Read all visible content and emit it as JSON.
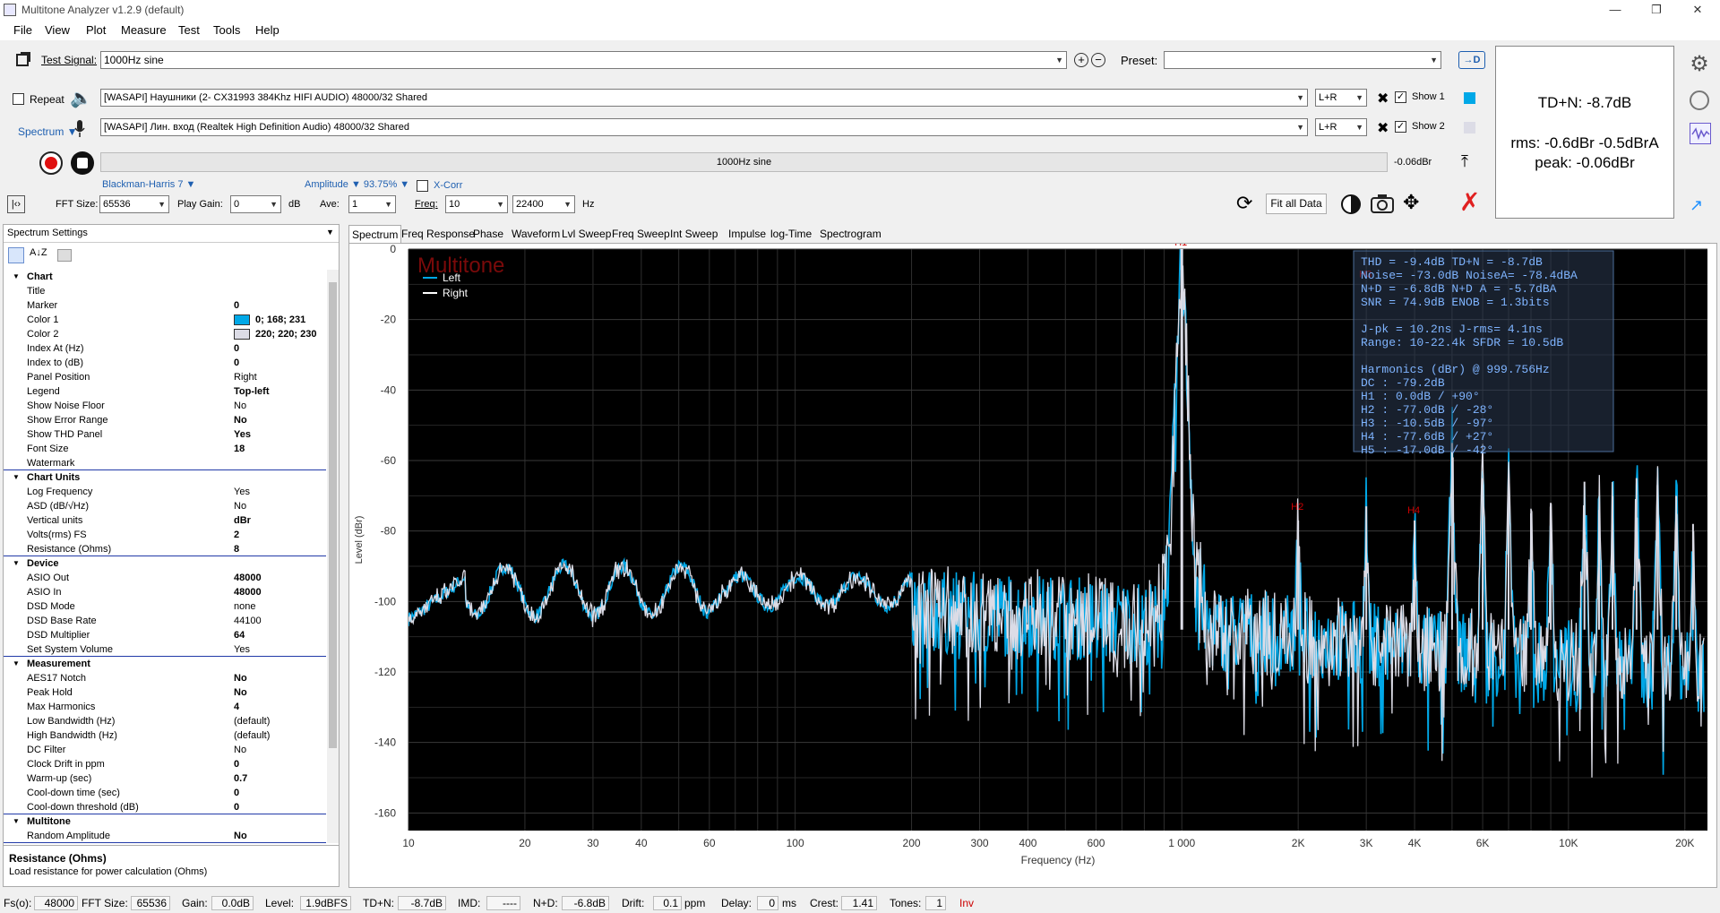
{
  "app": {
    "title": "Multitone Analyzer v1.2.9 (default)"
  },
  "menu": [
    "File",
    "View",
    "Plot",
    "Measure",
    "Test",
    "Tools",
    "Help"
  ],
  "toolbar": {
    "test_signal_label": "Test Signal:",
    "test_signal_value": "1000Hz sine",
    "preset_label": "Preset:",
    "preset_value": "",
    "repeat_label": "Repeat",
    "spectrum_label": "Spectrum ▼",
    "output_device": "[WASAPI] Наушники (2- CX31993 384Khz HIFI AUDIO) 48000/32 Shared",
    "input_device": "[WASAPI] Лин. вход (Realtek High Definition Audio) 48000/32 Shared",
    "output_channel": "L+R",
    "input_channel": "L+R",
    "show1_label": "Show 1",
    "show2_label": "Show 2",
    "signal_bar_text": "1000Hz sine",
    "level_text": "-0.06dBr",
    "window_label": "Blackman-Harris 7 ▼",
    "amplitude_label": "Amplitude ▼ 93.75% ▼",
    "xcorr_label": "X-Corr",
    "fft_size_label": "FFT Size:",
    "fft_size_value": "65536",
    "play_gain_label": "Play Gain:",
    "play_gain_value": "0",
    "play_gain_unit": "dB",
    "ave_label": "Ave:",
    "ave_value": "1",
    "freq_label": "Freq:",
    "freq_from": "10",
    "freq_to": "22400",
    "freq_unit": "Hz",
    "fit_all_label": "Fit all Data"
  },
  "colors": {
    "left": "#00a8e7",
    "right": "#dcdcdc",
    "plot_bg": "#000000",
    "grid": "#2e2e2e",
    "accent": "#1e90ff",
    "harm": "#cc0000"
  },
  "infobox": {
    "tdn": "TD+N: -8.7dB",
    "rms": "rms: -0.6dBr  -0.5dBrA",
    "peak": "peak: -0.06dBr"
  },
  "settings": {
    "header": "Spectrum Settings",
    "groups": [
      {
        "name": "Chart",
        "rows": [
          [
            "Title",
            ""
          ],
          [
            "Marker",
            "0"
          ],
          [
            "Color 1",
            "0; 168; 231"
          ],
          [
            "Color 2",
            "220; 220; 230"
          ],
          [
            "Index At (Hz)",
            "0"
          ],
          [
            "Index to (dB)",
            "0"
          ],
          [
            "Panel Position",
            "Right"
          ],
          [
            "Legend",
            "Top-left"
          ],
          [
            "Show Noise Floor",
            "No"
          ],
          [
            "Show Error Range",
            "No"
          ],
          [
            "Show THD Panel",
            "Yes"
          ],
          [
            "Font Size",
            "18"
          ],
          [
            "Watermark",
            ""
          ]
        ]
      },
      {
        "name": "Chart Units",
        "rows": [
          [
            "Log Frequency",
            "Yes"
          ],
          [
            "ASD (dB/√Hz)",
            "No"
          ],
          [
            "Vertical units",
            "dBr"
          ],
          [
            "Volts(rms) FS",
            "2"
          ],
          [
            "Resistance (Ohms)",
            "8"
          ]
        ]
      },
      {
        "name": "Device",
        "rows": [
          [
            "ASIO Out",
            "48000"
          ],
          [
            "ASIO In",
            "48000"
          ],
          [
            "DSD Mode",
            "none"
          ],
          [
            "DSD Base Rate",
            "44100"
          ],
          [
            "DSD Multiplier",
            "64"
          ],
          [
            "Set System Volume",
            "Yes"
          ]
        ]
      },
      {
        "name": "Measurement",
        "rows": [
          [
            "AES17 Notch",
            "No"
          ],
          [
            "Peak Hold",
            "No"
          ],
          [
            "Max Harmonics",
            "4"
          ],
          [
            "Low Bandwidth (Hz)",
            "(default)"
          ],
          [
            "High Bandwidth (Hz)",
            "(default)"
          ],
          [
            "DC Filter",
            "No"
          ],
          [
            "Clock Drift in ppm",
            "0"
          ],
          [
            "Warm-up (sec)",
            "0.7"
          ],
          [
            "Cool-down time (sec)",
            "0"
          ],
          [
            "Cool-down threshold (dB)",
            "0"
          ]
        ]
      },
      {
        "name": "Multitone",
        "rows": [
          [
            "Random Amplitude",
            "No"
          ]
        ]
      }
    ],
    "desc_title": "Resistance (Ohms)",
    "desc_text": "Load resistance for power calculation (Ohms)"
  },
  "tabs": [
    "Spectrum",
    "Freq Response",
    "Phase",
    "Waveform",
    "Lvl Sweep",
    "Freq Sweep",
    "Int Sweep",
    "Impulse",
    "log-Time",
    "Spectrogram"
  ],
  "chart_data": {
    "type": "line",
    "watermark": "Multitone",
    "xlabel": "Frequency (Hz)",
    "ylabel": "Level (dBr)",
    "xscale": "log",
    "xlim": [
      10,
      22400
    ],
    "ylim": [
      -165,
      0
    ],
    "grid": true,
    "legend": "top-left",
    "xticks": [
      "10",
      "20",
      "30",
      "40",
      "60",
      "100",
      "200",
      "300",
      "400",
      "600",
      "1 000",
      "2K",
      "3K",
      "4K",
      "6K",
      "10K",
      "20K"
    ],
    "yticks": [
      "0",
      "-20",
      "-40",
      "-60",
      "-80",
      "-100",
      "-120",
      "-140",
      "-160"
    ],
    "series": [
      {
        "name": "Left",
        "color": "#00a8e7"
      },
      {
        "name": "Right",
        "color": "#ffffff"
      }
    ],
    "fundamental_hz": 1000,
    "harmonic_peaks": [
      {
        "f": 1000,
        "y": 0
      },
      {
        "f": 2000,
        "y": -77
      },
      {
        "f": 3000,
        "y": -73
      },
      {
        "f": 4000,
        "y": -77
      },
      {
        "f": 5000,
        "y": -55
      },
      {
        "f": 6000,
        "y": -65
      },
      {
        "f": 7000,
        "y": -66
      },
      {
        "f": 8000,
        "y": -75
      },
      {
        "f": 9000,
        "y": -72
      },
      {
        "f": 11000,
        "y": -66
      },
      {
        "f": 12000,
        "y": -74
      },
      {
        "f": 13000,
        "y": -70
      },
      {
        "f": 15000,
        "y": -65
      },
      {
        "f": 17000,
        "y": -67
      },
      {
        "f": 19000,
        "y": -70
      },
      {
        "f": 21000,
        "y": -78
      }
    ],
    "harmonic_labels": [
      {
        "text": "H1",
        "f": 1000,
        "y": 0
      },
      {
        "text": "H2",
        "f": 2000,
        "y": -75
      },
      {
        "text": "H3",
        "f": 3000,
        "y": -9
      },
      {
        "text": "H4",
        "f": 4000,
        "y": -76
      }
    ],
    "thd_panel": [
      "THD   =   -9.4dB     TD+N  =   -8.7dB",
      "Noise= -73.0dB     NoiseA= -78.4dBA",
      "N+D   =  -6.8dB      N+D A  =   -5.7dBA",
      "SNR   =  74.9dB      ENOB  =    1.3bits",
      "",
      "J-pk  =  10.2ns      J-rms=    4.1ns",
      "Range:  10-22.4k    SFDR  =   10.5dB",
      "",
      "Harmonics (dBr) @ 999.756Hz",
      "DC  :   -79.2dB",
      "H1  :    0.0dB /  +90°",
      "H2  :  -77.0dB /  -28°",
      "H3  :  -10.5dB /  -97°",
      "H4  :  -77.6dB /  +27°",
      "H5  :  -17.0dB /  -42°"
    ]
  },
  "status": {
    "fs_label": "Fs(o):",
    "fs": "48000",
    "fft_label": "FFT Size:",
    "fft": "65536",
    "gain_label": "Gain:",
    "gain": "0.0dB",
    "level_label": "Level:",
    "level": "1.9dBFS",
    "tdn_label": "TD+N:",
    "tdn": "-8.7dB",
    "imd_label": "IMD:",
    "imd": "----",
    "nd_label": "N+D:",
    "nd": "-6.8dB",
    "drift_label": "Drift:",
    "drift": "0.1",
    "drift_unit": "ppm",
    "delay_label": "Delay:",
    "delay": "0",
    "delay_unit": "ms",
    "crest_label": "Crest:",
    "crest": "1.41",
    "tones_label": "Tones:",
    "tones": "1",
    "inv": "Inv"
  }
}
